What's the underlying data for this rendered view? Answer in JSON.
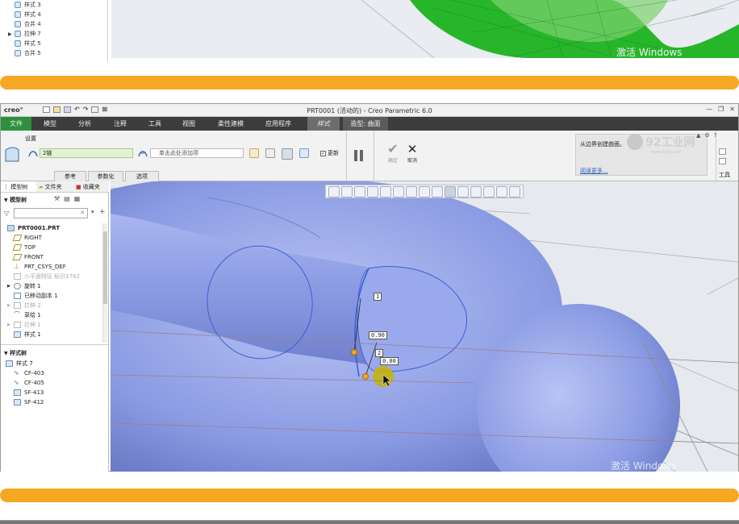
{
  "top_shot": {
    "tree_items": [
      "样式 3",
      "样式 4",
      "合并 4",
      "拉伸 7",
      "样式 5",
      "合并 5"
    ],
    "watermark": "激活 Windows"
  },
  "window": {
    "logo": "creo°",
    "title": "PRT0001 (活动的) - Creo Parametric 6.0"
  },
  "menu": {
    "items": [
      "文件",
      "模型",
      "分析",
      "注释",
      "工具",
      "视图",
      "柔性建模",
      "应用程序",
      "样式",
      "造型: 曲面"
    ]
  },
  "ribbon": {
    "group_label": "设置",
    "chain_value": "2链",
    "add_placeholder": "单击此处添加项",
    "update_label": "更新",
    "ok_label": "确定",
    "cancel_label": "取消",
    "tabs": [
      "参考",
      "参数化",
      "选项"
    ],
    "help_text": "从边界创建曲面。",
    "more_link": "阅读更多...",
    "tools_label": "工具",
    "site_logo": "92工业网",
    "site_url": "www.92gy.com"
  },
  "left_panel": {
    "tabs": [
      "模型树",
      "文件夹",
      "收藏夹"
    ],
    "tree_title": "模型树",
    "model_items": [
      {
        "label": "PRT0001.PRT",
        "muted": false
      },
      {
        "label": "RIGHT",
        "muted": false
      },
      {
        "label": "TOP",
        "muted": false
      },
      {
        "label": "FRONT",
        "muted": false
      },
      {
        "label": "PRT_CSYS_DEF",
        "muted": false
      },
      {
        "label": "小平面特征 标识1762",
        "muted": true
      },
      {
        "label": "旋转 1",
        "muted": false
      },
      {
        "label": "已移动副本 1",
        "muted": false
      },
      {
        "label": "拉伸 2",
        "muted": true
      },
      {
        "label": "草绘 1",
        "muted": false
      },
      {
        "label": "拉伸 1",
        "muted": true
      },
      {
        "label": "样式 1",
        "muted": false
      }
    ],
    "style_tree_title": "样式树",
    "style_items": [
      "样式 7",
      "CF-403",
      "CF-405",
      "SF-413",
      "SF-412"
    ]
  },
  "viewport": {
    "dims": [
      "1",
      "0.90",
      "2",
      "0.00"
    ],
    "watermark": "激活 Windows"
  },
  "colors": {
    "accent_band": "#f7a823",
    "menubar": "#3c3c3c",
    "active_tab": "#2f8f3a",
    "surface": "#8f9fe6"
  }
}
